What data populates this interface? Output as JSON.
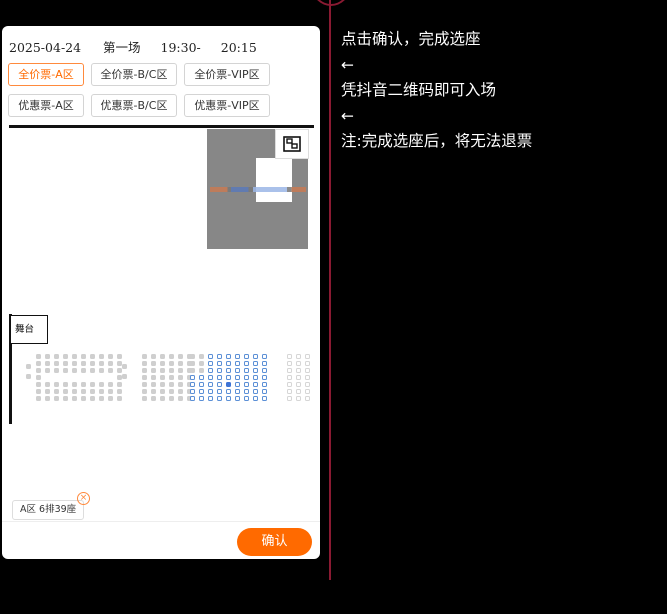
{
  "session": {
    "date": "2025-04-24",
    "name": "第一场",
    "start": "19:30-",
    "end": "20:15"
  },
  "tickets": [
    {
      "label": "全价票-A区",
      "active": true
    },
    {
      "label": "全价票-B/C区",
      "active": false
    },
    {
      "label": "全价票-VIP区",
      "active": false
    },
    {
      "label": "优惠票-A区",
      "active": false
    },
    {
      "label": "优惠票-B/C区",
      "active": false
    },
    {
      "label": "优惠票-VIP区",
      "active": false
    }
  ],
  "stage_label": "舞台",
  "selected_seat": "A区 6排39座",
  "confirm_label": "确认",
  "notes": [
    "点击确认，完成选座",
    "←",
    "凭抖音二维码即可入场",
    "←",
    "注:完成选座后，将无法退票"
  ],
  "colors": {
    "accent": "#ff6a00",
    "divider": "#8a1a32",
    "seat_selected": "#3e74d6"
  }
}
